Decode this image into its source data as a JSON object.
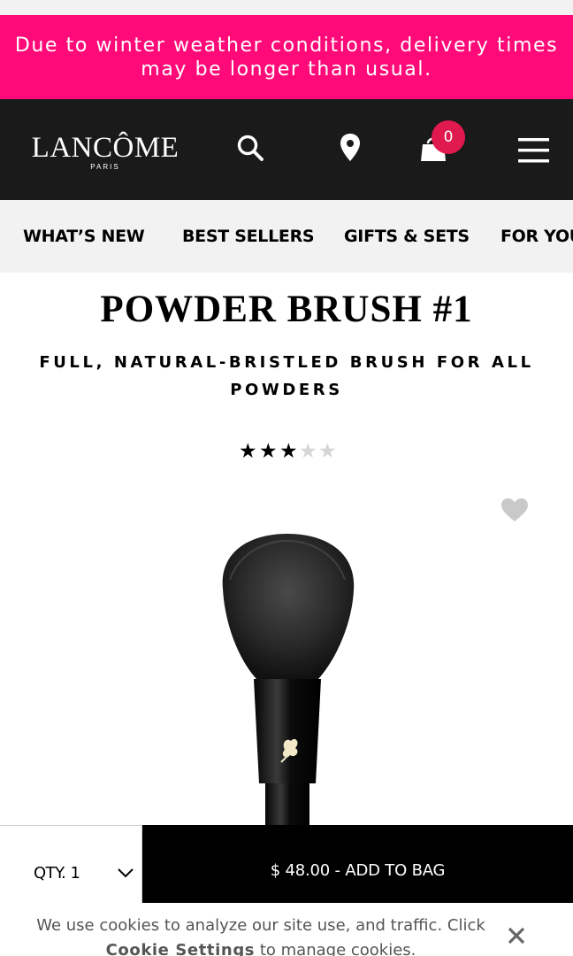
{
  "banner": {
    "line1": "Due to winter weather conditions, delivery times",
    "line2": "may be longer than usual."
  },
  "header": {
    "logo_main": "LANCÔME",
    "logo_sub": "PARIS",
    "cart_count": "0",
    "icons": [
      "search-icon",
      "location-icon",
      "shopping-bag-icon",
      "hamburger-menu-icon"
    ]
  },
  "nav": {
    "items": [
      {
        "label": "WHAT’S NEW"
      },
      {
        "label": "BEST SELLERS"
      },
      {
        "label": "GIFTS & SETS"
      },
      {
        "label": "FOR YOU"
      }
    ]
  },
  "product": {
    "title": "POWDER BRUSH #1",
    "subtitle_line1": "FULL, NATURAL-BRISTLED BRUSH FOR ALL",
    "subtitle_line2": "POWDERS",
    "rating": 3,
    "rating_max": 5,
    "wishlist_icon": "heart-icon"
  },
  "purchase": {
    "qty_label": "QTY. 1",
    "add_to_bag_label": "$ 48.00 - ADD TO BAG"
  },
  "cookie": {
    "text_before": "We use cookies to analyze our site use, and traffic. Click",
    "link": "Cookie Settings",
    "text_after": "to manage cookies."
  },
  "colors": {
    "banner": "#ff0a78",
    "header": "#1a1a1a",
    "cart_badge": "#e0194f",
    "nav_bg": "#f2f2f2",
    "button": "#000000"
  }
}
